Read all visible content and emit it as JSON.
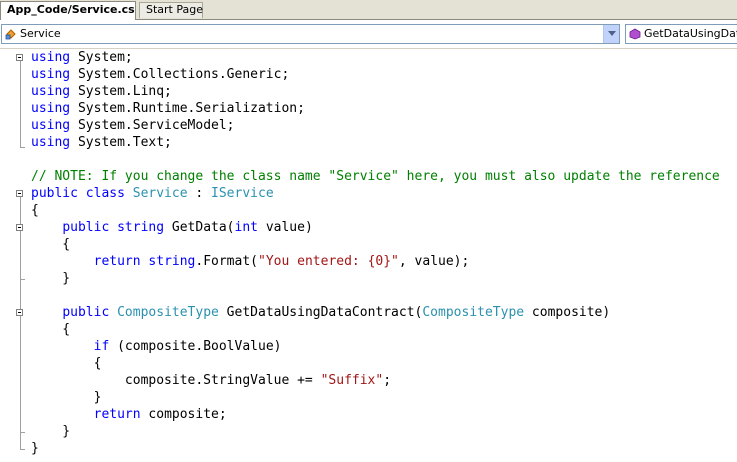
{
  "tabs": [
    {
      "label": "App_Code/Service.cs",
      "active": true
    },
    {
      "label": "Start Page",
      "active": false
    }
  ],
  "navbar": {
    "class_combo": {
      "value": "Service",
      "icon": "class-icon"
    },
    "member_combo": {
      "value": "GetDataUsingDataC",
      "icon": "method-icon"
    }
  },
  "colors": {
    "keyword": "#0000ff",
    "type": "#2b91af",
    "string": "#a31515",
    "comment": "#008000"
  },
  "code": {
    "l1": {
      "a": "using",
      "b": " System;"
    },
    "l2": {
      "a": "using",
      "b": " System.Collections.Generic;"
    },
    "l3": {
      "a": "using",
      "b": " System.Linq;"
    },
    "l4": {
      "a": "using",
      "b": " System.Runtime.Serialization;"
    },
    "l5": {
      "a": "using",
      "b": " System.ServiceModel;"
    },
    "l6": {
      "a": "using",
      "b": " System.Text;"
    },
    "l7": {
      "a": "// NOTE: If you change the class name \"Service\" here, you must also update the reference"
    },
    "l8": {
      "a": "public class",
      "b": " ",
      "c": "Service",
      "d": " : ",
      "e": "IService"
    },
    "l9": {
      "a": "{"
    },
    "l10": {
      "a": "    ",
      "b": "public string",
      "c": " GetData(",
      "d": "int",
      "e": " value)"
    },
    "l11": {
      "a": "    {"
    },
    "l12": {
      "a": "        ",
      "b": "return string",
      "c": ".Format(",
      "d": "\"You entered: {0}\"",
      "e": ", value);"
    },
    "l13": {
      "a": "    }"
    },
    "l14": {
      "a": "    ",
      "b": "public",
      "c": " ",
      "d": "CompositeType",
      "e": " GetDataUsingDataContract(",
      "f": "CompositeType",
      "g": " composite)"
    },
    "l15": {
      "a": "    {"
    },
    "l16": {
      "a": "        ",
      "b": "if",
      "c": " (composite.BoolValue)"
    },
    "l17": {
      "a": "        {"
    },
    "l18": {
      "a": "            composite.StringValue += ",
      "b": "\"Suffix\"",
      "c": ";"
    },
    "l19": {
      "a": "        }"
    },
    "l20": {
      "a": "        ",
      "b": "return",
      "c": " composite;"
    },
    "l21": {
      "a": "    }"
    },
    "l22": {
      "a": "}"
    }
  }
}
